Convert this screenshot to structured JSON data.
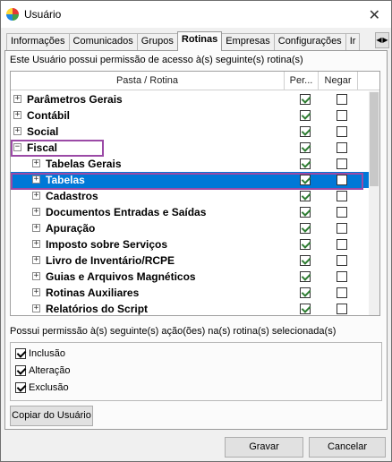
{
  "window": {
    "title": "Usuário"
  },
  "tabs": [
    "Informações",
    "Comunicados",
    "Grupos",
    "Rotinas",
    "Empresas",
    "Configurações",
    "Ir"
  ],
  "active_tab": "Rotinas",
  "intro_text": "Este Usuário possui permissão de acesso à(s) seguinte(s) rotina(s)",
  "grid": {
    "headers": {
      "pasta": "Pasta / Rotina",
      "per": "Per...",
      "negar": "Negar"
    },
    "rows": [
      {
        "label": "Parâmetros Gerais",
        "expander": "+",
        "level": 0,
        "per": true,
        "negar": false
      },
      {
        "label": "Contábil",
        "expander": "+",
        "level": 0,
        "per": true,
        "negar": false
      },
      {
        "label": "Social",
        "expander": "+",
        "level": 0,
        "per": true,
        "negar": false
      },
      {
        "label": "Fiscal",
        "expander": "−",
        "level": 0,
        "per": true,
        "negar": false
      },
      {
        "label": "Tabelas Gerais",
        "expander": "+",
        "level": 1,
        "per": true,
        "negar": false
      },
      {
        "label": "Tabelas",
        "expander": "+",
        "level": 1,
        "per": true,
        "negar": false,
        "selected": true
      },
      {
        "label": "Cadastros",
        "expander": "+",
        "level": 1,
        "per": true,
        "negar": false
      },
      {
        "label": "Documentos Entradas e Saídas",
        "expander": "+",
        "level": 1,
        "per": true,
        "negar": false
      },
      {
        "label": "Apuração",
        "expander": "+",
        "level": 1,
        "per": true,
        "negar": false
      },
      {
        "label": "Imposto sobre Serviços",
        "expander": "+",
        "level": 1,
        "per": true,
        "negar": false
      },
      {
        "label": "Livro de Inventário/RCPE",
        "expander": "+",
        "level": 1,
        "per": true,
        "negar": false
      },
      {
        "label": "Guias e Arquivos Magnéticos",
        "expander": "+",
        "level": 1,
        "per": true,
        "negar": false
      },
      {
        "label": "Rotinas Auxiliares",
        "expander": "+",
        "level": 1,
        "per": true,
        "negar": false
      },
      {
        "label": "Relatórios do Script",
        "expander": "+",
        "level": 1,
        "per": true,
        "negar": false
      }
    ]
  },
  "permissions_label": "Possui permissão à(s) seguinte(s) ação(ões) na(s) rotina(s) selecionada(s)",
  "permissions": [
    {
      "label": "Inclusão",
      "checked": true
    },
    {
      "label": "Alteração",
      "checked": true
    },
    {
      "label": "Exclusão",
      "checked": true
    }
  ],
  "buttons": {
    "copy": "Copiar do Usuário",
    "save": "Gravar",
    "cancel": "Cancelar"
  },
  "colors": {
    "selection": "#0078d7",
    "highlight": "#9b4aa6",
    "check": "#2e7d32"
  }
}
